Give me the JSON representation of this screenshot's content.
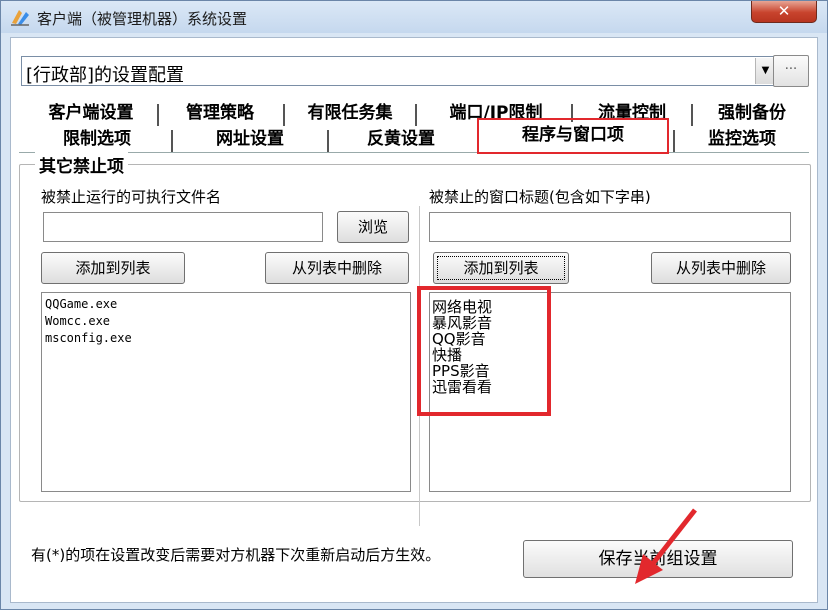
{
  "window": {
    "title": "客户端（被管理机器）系统设置",
    "close_label": "✕"
  },
  "config": {
    "selected_value": "[行政部]的设置配置",
    "more_button_label": "···"
  },
  "tabs": {
    "row1": [
      "客户端设置",
      "管理策略",
      "有限任务集",
      "端口/IP限制",
      "流量控制",
      "强制备份"
    ],
    "row2": [
      "限制选项",
      "网址设置",
      "反黄设置",
      "程序与窗口项",
      "监控选项"
    ],
    "active": "程序与窗口项"
  },
  "group": {
    "title": "其它禁止项",
    "left": {
      "label": "被禁止运行的可执行文件名",
      "input_value": "",
      "browse_label": "浏览",
      "add_label": "添加到列表",
      "remove_label": "从列表中删除",
      "items": [
        "QQGame.exe",
        "Womcc.exe",
        "msconfig.exe"
      ]
    },
    "right": {
      "label": "被禁止的窗口标题(包含如下字串)",
      "input_value": "",
      "add_label": "添加到列表",
      "remove_label": "从列表中删除",
      "items": [
        "网络电视",
        "暴风影音",
        "QQ影音",
        "快播",
        "PPS影音",
        "迅雷看看"
      ]
    }
  },
  "footer": {
    "note": "有(*)的项在设置改变后需要对方机器下次重新启动后方生效。",
    "save_label": "保存当前组设置"
  },
  "colors": {
    "highlight": "#e2282d"
  }
}
